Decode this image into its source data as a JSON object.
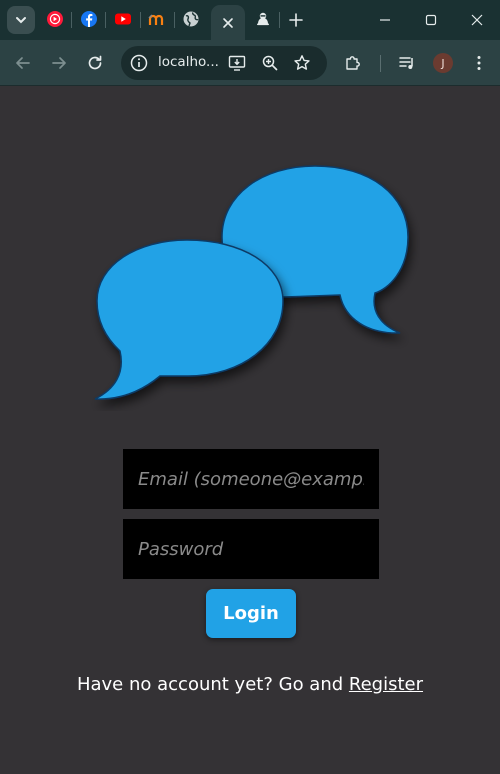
{
  "browser": {
    "address_text": "localho...",
    "profile_initial": "J"
  },
  "login": {
    "email_placeholder": "Email (someone@example.com)",
    "password_placeholder": "Password",
    "button_label": "Login",
    "register_prompt": "Have no account yet? Go and",
    "register_link": "Register"
  },
  "colors": {
    "accent": "#21a2e6",
    "page_background": "#343235",
    "browser_chrome": "#2c4244"
  },
  "icons": {
    "tab_icons": [
      "tab-search-icon",
      "youtube-music-icon",
      "facebook-icon",
      "youtube-icon",
      "moodle-icon",
      "globe-icon",
      "close-icon",
      "app-icon",
      "new-tab-icon"
    ],
    "toolbar_icons": [
      "back-icon",
      "forward-icon",
      "reload-icon",
      "site-info-icon",
      "install-app-icon",
      "zoom-icon",
      "bookmark-star-icon",
      "extensions-icon",
      "reading-list-icon",
      "menu-icon"
    ],
    "logo": "chat-bubbles-logo"
  }
}
